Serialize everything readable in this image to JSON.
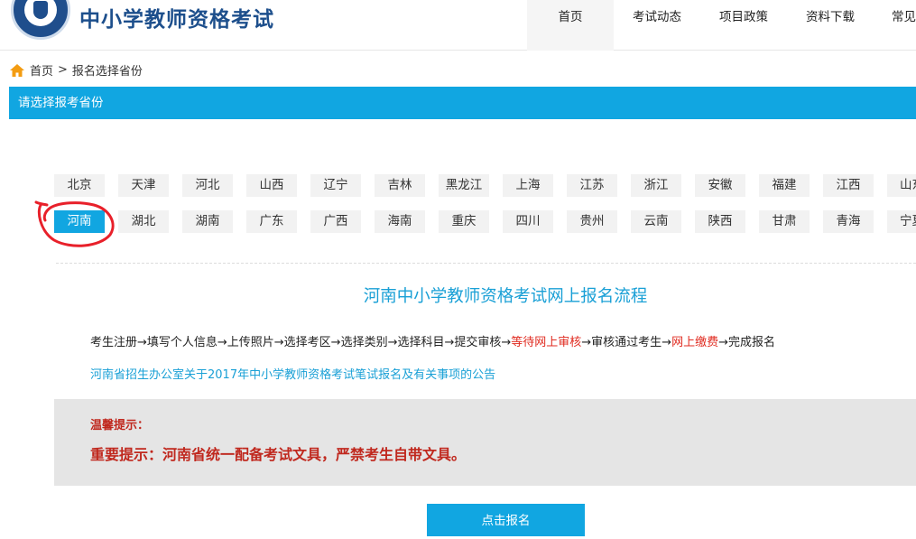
{
  "header": {
    "title": "中小学教师资格考试",
    "nav": [
      "首页",
      "考试动态",
      "项目政策",
      "资料下载",
      "常见"
    ],
    "active_index": 0
  },
  "breadcrumb": {
    "home": "首页",
    "separator": ">",
    "current": "报名选择省份"
  },
  "section": {
    "title": "请选择报考省份"
  },
  "provinces": {
    "row1": [
      "北京",
      "天津",
      "河北",
      "山西",
      "辽宁",
      "吉林",
      "黑龙江",
      "上海",
      "江苏",
      "浙江",
      "安徽",
      "福建",
      "江西",
      "山东"
    ],
    "row2": [
      "河南",
      "湖北",
      "湖南",
      "广东",
      "广西",
      "海南",
      "重庆",
      "四川",
      "贵州",
      "云南",
      "陕西",
      "甘肃",
      "青海",
      "宁夏"
    ],
    "selected": "河南"
  },
  "flow": {
    "title": "河南中小学教师资格考试网上报名流程",
    "steps": [
      {
        "text": "考生注册→填写个人信息→上传照片→选择考区→选择类别→选择科目→提交审核→",
        "highlight": false
      },
      {
        "text": "等待网上审核",
        "highlight": true
      },
      {
        "text": "→审核通过考生→",
        "highlight": false
      },
      {
        "text": "网上缴费",
        "highlight": true
      },
      {
        "text": "→完成报名",
        "highlight": false
      }
    ],
    "notice_link": "河南省招生办公室关于2017年中小学教师资格考试笔试报名及有关事项的公告"
  },
  "tips": {
    "label": "温馨提示：",
    "text": "重要提示：河南省统一配备考试文具，严禁考生自带文具。"
  },
  "actions": {
    "register_label": "点击报名"
  },
  "colors": {
    "accent": "#11a6e1",
    "warning": "#c0281e",
    "brand": "#1d4f8c",
    "annotation": "#e8202a"
  }
}
